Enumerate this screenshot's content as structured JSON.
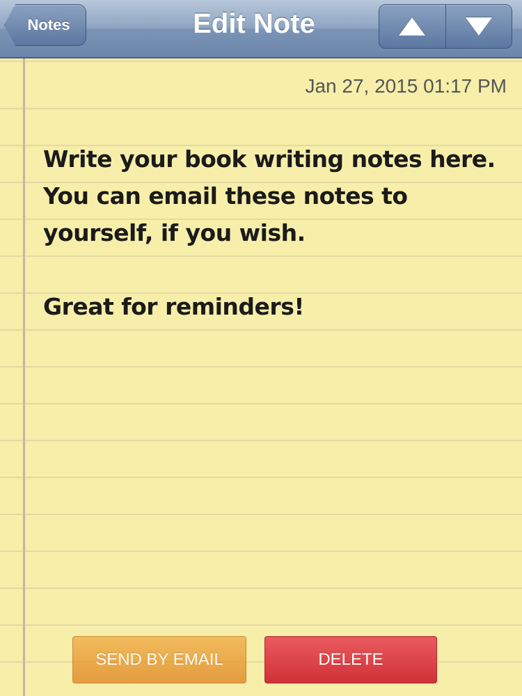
{
  "navbar": {
    "back_label": "Notes",
    "title": "Edit Note",
    "prev_icon": "arrow-up-icon",
    "next_icon": "arrow-down-icon"
  },
  "note": {
    "timestamp": "Jan 27, 2015 01:17 PM",
    "body": "Write your book writing notes here. You can email these notes to yourself, if you wish.\n\nGreat for reminders!"
  },
  "actions": {
    "send_email_label": "SEND BY EMAIL",
    "delete_label": "DELETE"
  },
  "colors": {
    "paper": "#f7eeaa",
    "navbar": "#7a94b6",
    "email_button": "#e99f3a",
    "delete_button": "#d9393f"
  }
}
